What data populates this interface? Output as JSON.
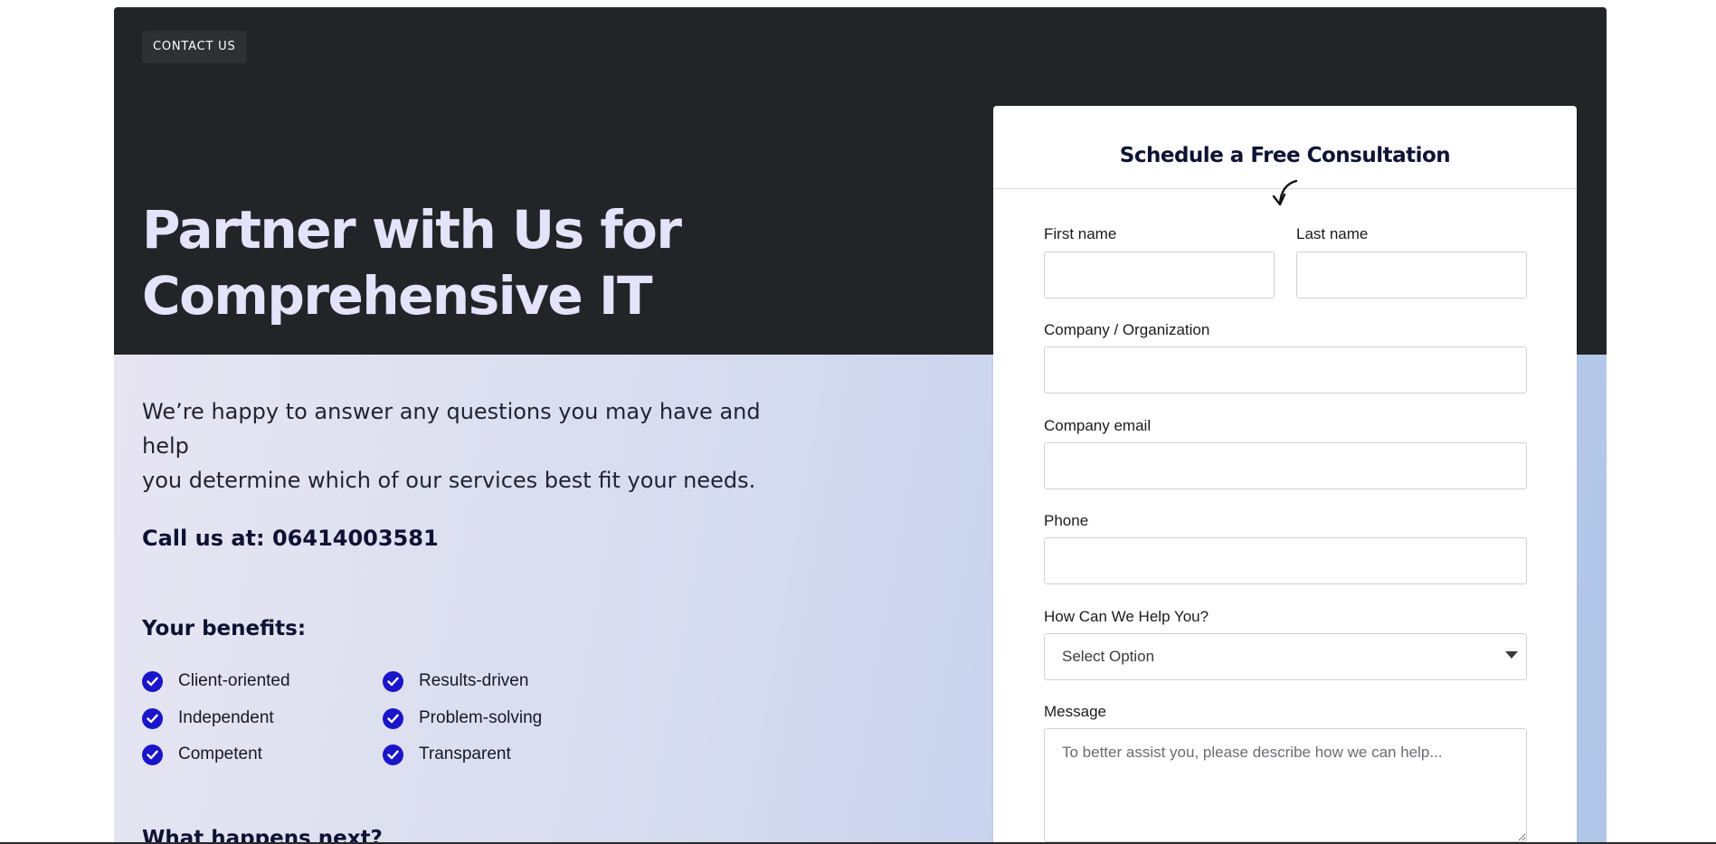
{
  "hero": {
    "tag": "CONTACT US",
    "title_line1": "Partner with Us for",
    "title_line2": "Comprehensive IT"
  },
  "intro": {
    "line1": "We’re happy to answer any questions you may have and help",
    "line2": "you determine which of our services best fit your needs."
  },
  "call": "Call us at: 06414003581",
  "benefits": {
    "title": "Your benefits:",
    "items": [
      "Client-oriented",
      "Results-driven",
      "Independent",
      "Problem-solving",
      "Competent",
      "Transparent"
    ]
  },
  "next_title": "What happens next?",
  "form": {
    "title": "Schedule a Free Consultation",
    "first_name_label": "First name",
    "last_name_label": "Last name",
    "company_label": "Company / Organization",
    "email_label": "Company email",
    "phone_label": "Phone",
    "help_label": "How Can We Help You?",
    "help_selected": "Select Option",
    "message_label": "Message",
    "message_placeholder": "To better assist you, please describe how we can help..."
  },
  "colors": {
    "hero_bg": "#232427",
    "accent": "#1a15c9",
    "hero_title": "#e3e3fa"
  },
  "icons": {
    "check": "check-circle-icon",
    "arrow": "curved-arrow-down-icon",
    "caret": "caret-down-icon"
  }
}
